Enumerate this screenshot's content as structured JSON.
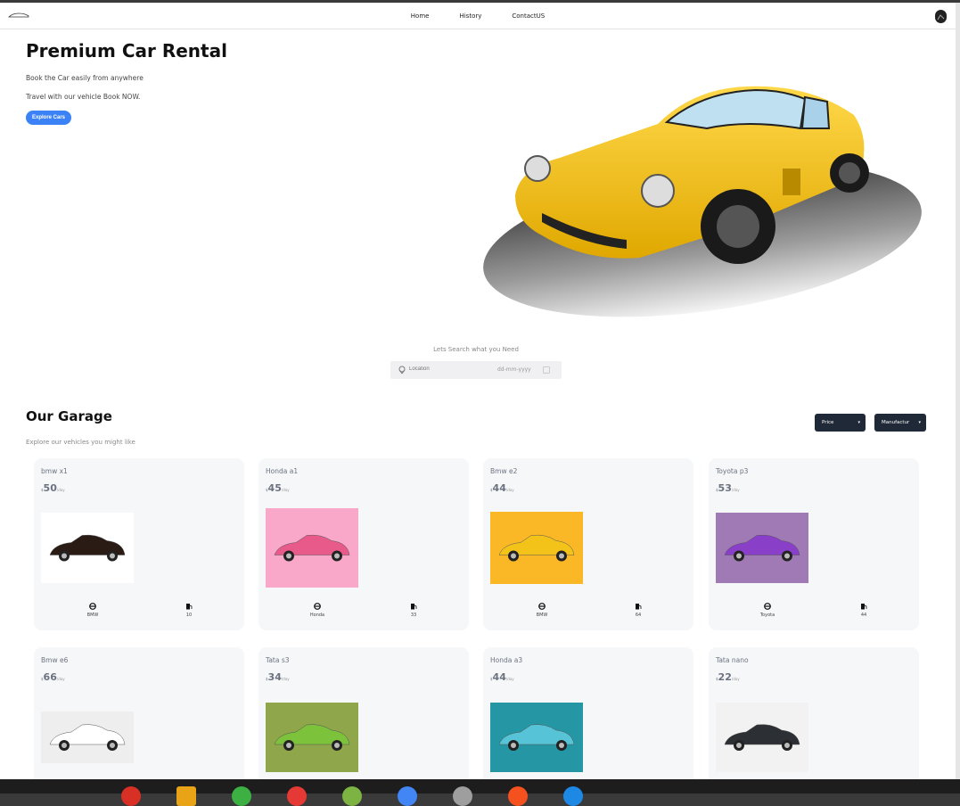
{
  "nav": {
    "links": [
      "Home",
      "History",
      "ContactUS"
    ]
  },
  "hero": {
    "title": "Premium Car Rental",
    "line1": "Book the Car easily from anywhere",
    "line2": "Travel with our vehicle Book NOW.",
    "cta": "Explore Cars"
  },
  "search": {
    "title": "Lets Search what you Need",
    "location_placeholder": "Location",
    "date_placeholder": "dd-mm-yyyy"
  },
  "garage": {
    "title": "Our Garage",
    "subtitle": "Explore our vehicles you might like",
    "filters": {
      "price": "Price",
      "manufacturer": "Manufactur"
    },
    "cards": [
      {
        "name": "bmw x1",
        "currency": "$",
        "price": "50",
        "per": "/day",
        "maker": "BMW",
        "mileage": "10",
        "photo_color": "#ffffff",
        "car_color": "#2a1b14"
      },
      {
        "name": "Honda a1",
        "currency": "$",
        "price": "45",
        "per": "/day",
        "maker": "Honda",
        "mileage": "33",
        "photo_color": "#f9a8c9",
        "car_color": "#e85a8a"
      },
      {
        "name": "Bmw e2",
        "currency": "$",
        "price": "44",
        "per": "/day",
        "maker": "BMW",
        "mileage": "64",
        "photo_color": "#fbb826",
        "car_color": "#f3c31a"
      },
      {
        "name": "Toyota p3",
        "currency": "$",
        "price": "53",
        "per": "/day",
        "maker": "Toyota",
        "mileage": "44",
        "photo_color": "#a07ab4",
        "car_color": "#8a3fc9"
      },
      {
        "name": "Bmw e6",
        "currency": "$",
        "price": "66",
        "per": "/day",
        "maker": "",
        "mileage": "",
        "photo_color": "#eeeeee",
        "car_color": "#ffffff"
      },
      {
        "name": "Tata s3",
        "currency": "$",
        "price": "34",
        "per": "/day",
        "maker": "",
        "mileage": "",
        "photo_color": "#8fa64a",
        "car_color": "#7cc23a"
      },
      {
        "name": "Honda a3",
        "currency": "$",
        "price": "44",
        "per": "/day",
        "maker": "",
        "mileage": "",
        "photo_color": "#2596a3",
        "car_color": "#56c3d6"
      },
      {
        "name": "Tata nano",
        "currency": "$",
        "price": "22",
        "per": "/day",
        "maker": "",
        "mileage": "",
        "photo_color": "#f2f2f2",
        "car_color": "#2c2f33"
      }
    ]
  },
  "colors": {
    "accent": "#3b82f6",
    "filter_bg": "#1f2937",
    "card_bg": "#f6f7f9",
    "hero_car": "#f5c518"
  },
  "icons": [
    "steering-wheel-icon",
    "fuel-pump-icon",
    "location-pin-icon",
    "calendar-icon",
    "chevron-down-icon",
    "car-logo-icon",
    "user-avatar-icon"
  ]
}
